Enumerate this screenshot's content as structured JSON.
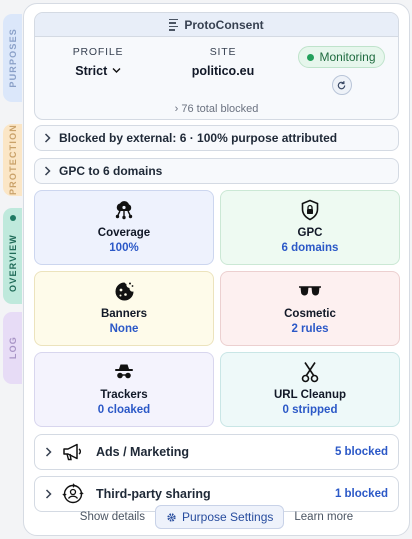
{
  "side_tabs": {
    "purposes": "PURPOSES",
    "protection": "PROTECTION",
    "overview": "OVERVIEW",
    "log": "LOG"
  },
  "header": {
    "title": "ProtoConsent",
    "profile_label": "PROFILE",
    "profile_value": "Strict",
    "site_label": "SITE",
    "site_value": "politico.eu",
    "status": "Monitoring",
    "total_blocked": "76 total blocked"
  },
  "summary_rows": {
    "blocked_external": "Blocked by external: 6 · 100% purpose attributed",
    "gpc": "GPC to 6 domains"
  },
  "tiles": [
    {
      "name": "Coverage",
      "value": "100%",
      "icon": "cloud-network-icon"
    },
    {
      "name": "GPC",
      "value": "6 domains",
      "icon": "shield-lock-icon"
    },
    {
      "name": "Banners",
      "value": "None",
      "icon": "cookie-icon"
    },
    {
      "name": "Cosmetic",
      "value": "2 rules",
      "icon": "sunglasses-icon"
    },
    {
      "name": "Trackers",
      "value": "0 cloaked",
      "icon": "spy-icon"
    },
    {
      "name": "URL Cleanup",
      "value": "0 stripped",
      "icon": "scissors-icon"
    }
  ],
  "purposes": [
    {
      "name": "Ads / Marketing",
      "count": "5 blocked",
      "icon": "megaphone-icon"
    },
    {
      "name": "Third-party sharing",
      "count": "1 blocked",
      "icon": "share-person-icon"
    }
  ],
  "footer": {
    "show_details": "Show details",
    "settings": "Purpose Settings",
    "learn_more": "Learn more"
  },
  "colors": {
    "accent_blue": "#2b58c7",
    "monitor_green": "#22a05b",
    "overview_tab": "#bfe9dc"
  }
}
